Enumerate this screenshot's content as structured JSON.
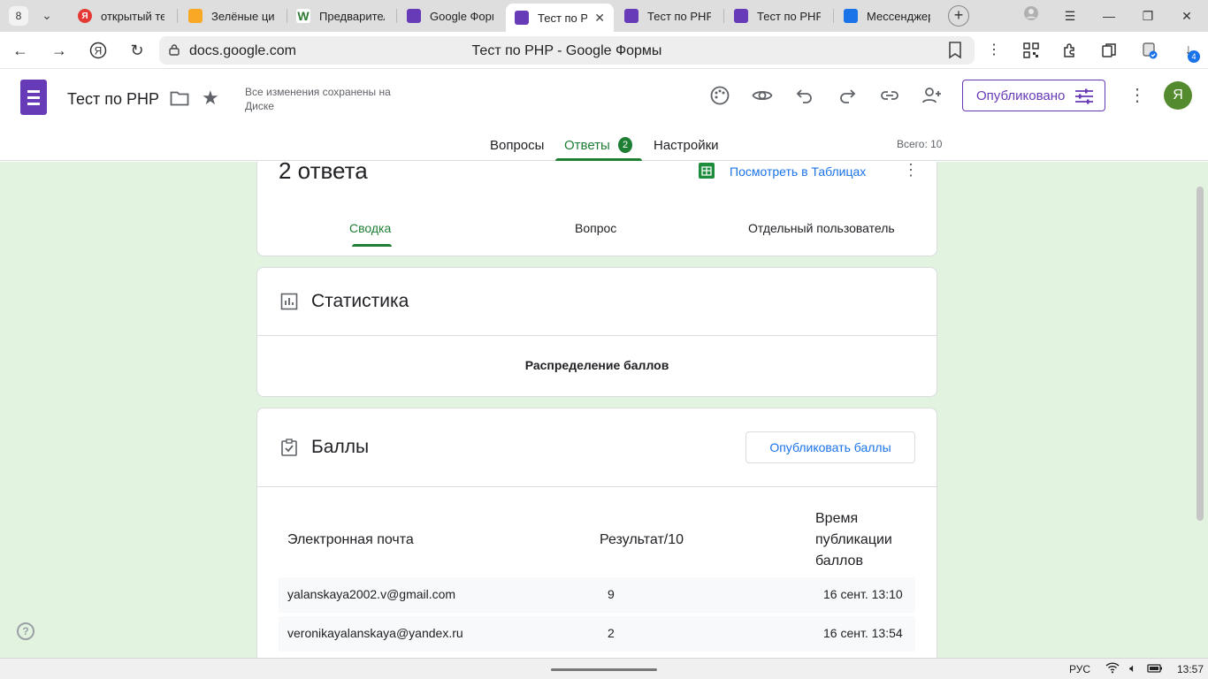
{
  "browser": {
    "tab_count": "8",
    "tabs": [
      {
        "label": "открытый те",
        "icon": "yandex-icon"
      },
      {
        "label": "Зелёные циф",
        "icon": "image-icon"
      },
      {
        "label": "Предварител",
        "icon": "w-icon"
      },
      {
        "label": "Google Форм",
        "icon": "forms-icon"
      },
      {
        "label": "Тест по PH",
        "icon": "forms-icon",
        "active": true
      },
      {
        "label": "Тест по PHP",
        "icon": "forms-icon"
      },
      {
        "label": "Тест по PHP",
        "icon": "forms-icon"
      },
      {
        "label": "Мессенджер",
        "icon": "messenger-icon"
      }
    ],
    "url_host": "docs.google.com",
    "page_title": "Тест по PHP - Google Формы",
    "download_badge": "4"
  },
  "form_header": {
    "title": "Тест по PHP",
    "save_status": "Все изменения сохранены на Диске",
    "publish_label": "Опубликовано",
    "avatar_letter": "Я",
    "tabs": {
      "questions": "Вопросы",
      "responses": "Ответы",
      "responses_badge": "2",
      "settings": "Настройки"
    },
    "total": "Всего: 10"
  },
  "responses_card": {
    "count_title": "2 ответа",
    "sheets_link": "Посмотреть в Таблицах",
    "subtabs": {
      "summary": "Сводка",
      "question": "Вопрос",
      "individual": "Отдельный пользователь"
    }
  },
  "stats_card": {
    "title": "Статистика",
    "distribution_label": "Распределение баллов"
  },
  "scores_card": {
    "title": "Баллы",
    "publish_scores": "Опубликовать баллы",
    "columns": {
      "email": "Электронная почта",
      "result": "Результат/10",
      "time_line1": "Время",
      "time_line2": "публикации",
      "time_line3": "баллов"
    },
    "rows": [
      {
        "email": "yalanskaya2002.v@gmail.com",
        "score": "9",
        "time": "16 сент. 13:10"
      },
      {
        "email": "veronikayalanskaya@yandex.ru",
        "score": "2",
        "time": "16 сент. 13:54"
      }
    ]
  },
  "taskbar": {
    "lang": "РУС",
    "time": "13:57"
  },
  "colors": {
    "forms_purple": "#673ab7",
    "accent_green": "#1e7e34",
    "page_bg": "#e2f3e0",
    "link_blue": "#1a73e8"
  }
}
